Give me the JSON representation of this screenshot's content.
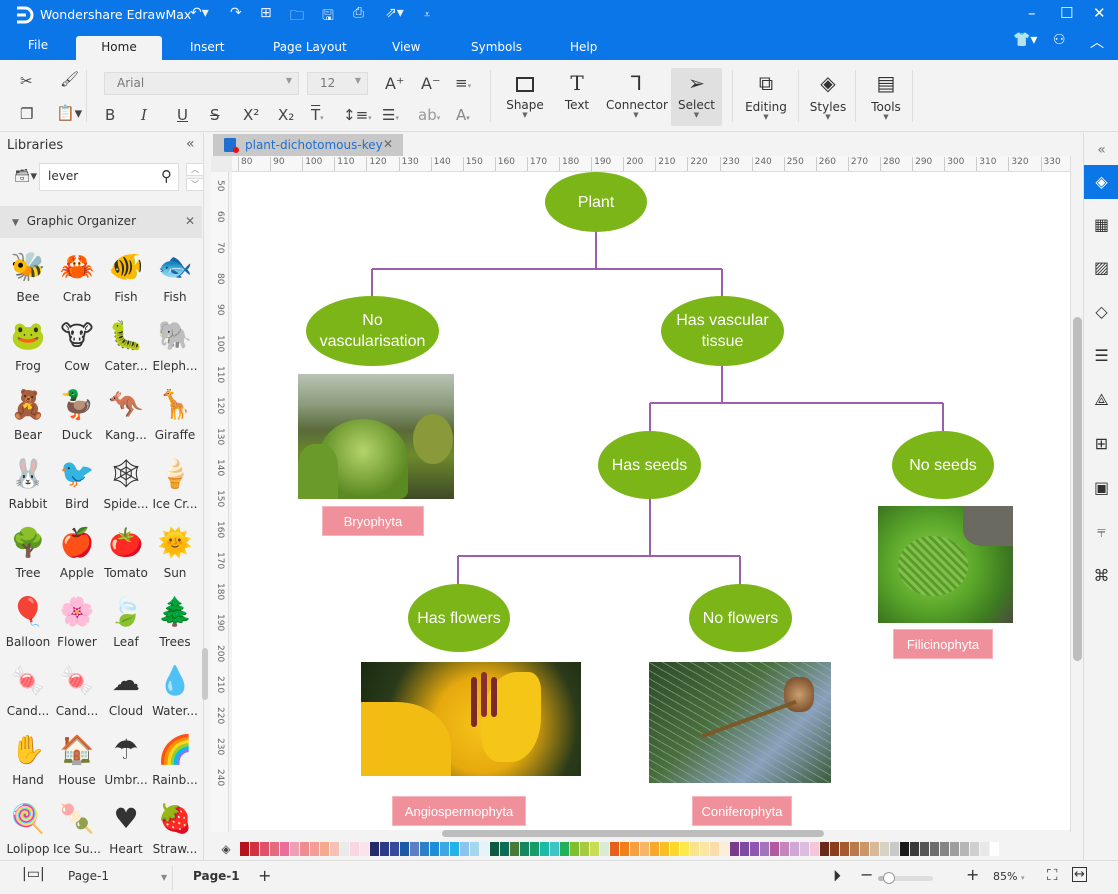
{
  "app": {
    "title": "Wondershare EdrawMax",
    "quick_access": [
      "undo-icon",
      "redo-icon",
      "new-icon",
      "open-icon",
      "save-icon",
      "print-icon",
      "export-icon",
      "customize-icon"
    ],
    "window_controls": {
      "minimize": "–",
      "maximize": "☐",
      "close": "✕"
    }
  },
  "menu": {
    "tabs": [
      "File",
      "Home",
      "Insert",
      "Page Layout",
      "View",
      "Symbols",
      "Help"
    ],
    "active": "Home"
  },
  "ribbon": {
    "font_name": "Arial",
    "font_size": "12",
    "buttons": [
      {
        "label": "Shape",
        "icon": "□"
      },
      {
        "label": "Text",
        "icon": "T"
      },
      {
        "label": "Connector",
        "icon": "⌐"
      },
      {
        "label": "Select",
        "icon": "⇖"
      },
      {
        "label": "Editing",
        "icon": "⧉"
      },
      {
        "label": "Styles",
        "icon": "◈"
      },
      {
        "label": "Tools",
        "icon": "▤"
      }
    ],
    "format_icons": {
      "bold": "B",
      "italic": "I",
      "underline": "U",
      "strike": "S",
      "superscript": "X²",
      "subscript": "X₂",
      "grow": "A⁺",
      "shrink": "A⁻",
      "align": "≡",
      "text": "T",
      "spacing": "↕≡",
      "list": "☰",
      "highlight": "ab",
      "fontcolor": "A"
    }
  },
  "library": {
    "title": "Libraries",
    "search_value": "lever",
    "category": "Graphic Organizer",
    "shapes": [
      {
        "name": "Bee",
        "glyph": "🐝"
      },
      {
        "name": "Crab",
        "glyph": "🦀"
      },
      {
        "name": "Fish",
        "glyph": "🐠"
      },
      {
        "name": "Fish",
        "glyph": "🐟"
      },
      {
        "name": "Frog",
        "glyph": "🐸"
      },
      {
        "name": "Cow",
        "glyph": "🐮"
      },
      {
        "name": "Cater...",
        "glyph": "🐛"
      },
      {
        "name": "Eleph...",
        "glyph": "🐘"
      },
      {
        "name": "Bear",
        "glyph": "🧸"
      },
      {
        "name": "Duck",
        "glyph": "🦆"
      },
      {
        "name": "Kang...",
        "glyph": "🦘"
      },
      {
        "name": "Giraffe",
        "glyph": "🦒"
      },
      {
        "name": "Rabbit",
        "glyph": "🐰"
      },
      {
        "name": "Bird",
        "glyph": "🐦"
      },
      {
        "name": "Spide...",
        "glyph": "🕸"
      },
      {
        "name": "Ice Cr...",
        "glyph": "🍦"
      },
      {
        "name": "Tree",
        "glyph": "🌳"
      },
      {
        "name": "Apple",
        "glyph": "🍎"
      },
      {
        "name": "Tomato",
        "glyph": "🍅"
      },
      {
        "name": "Sun",
        "glyph": "🌞"
      },
      {
        "name": "Balloon",
        "glyph": "🎈"
      },
      {
        "name": "Flower",
        "glyph": "🌸"
      },
      {
        "name": "Leaf",
        "glyph": "🍃"
      },
      {
        "name": "Trees",
        "glyph": "🌲"
      },
      {
        "name": "Cand...",
        "glyph": "🍬"
      },
      {
        "name": "Cand...",
        "glyph": "🍬"
      },
      {
        "name": "Cloud",
        "glyph": "☁"
      },
      {
        "name": "Water...",
        "glyph": "💧"
      },
      {
        "name": "Hand",
        "glyph": "✋"
      },
      {
        "name": "House",
        "glyph": "🏠"
      },
      {
        "name": "Umbr...",
        "glyph": "☂"
      },
      {
        "name": "Rainb...",
        "glyph": "🌈"
      },
      {
        "name": "Lolipop",
        "glyph": "🍭"
      },
      {
        "name": "Ice Su...",
        "glyph": "🍡"
      },
      {
        "name": "Heart",
        "glyph": "♥"
      },
      {
        "name": "Straw...",
        "glyph": "🍓"
      }
    ]
  },
  "document": {
    "tab_title": "plant-dichotomous-key",
    "hruler": [
      "80",
      "90",
      "100",
      "110",
      "120",
      "130",
      "140",
      "150",
      "160",
      "170",
      "180",
      "190",
      "200",
      "210",
      "220",
      "230",
      "240",
      "250",
      "260",
      "270",
      "280",
      "290",
      "300",
      "310",
      "320",
      "330"
    ],
    "vruler": [
      "50",
      "60",
      "70",
      "80",
      "90",
      "100",
      "110",
      "120",
      "130",
      "140",
      "150",
      "160",
      "170",
      "180",
      "190",
      "200",
      "210",
      "220",
      "230",
      "240"
    ]
  },
  "diagram": {
    "node_color": "#7cb518",
    "connector_color": "#9b5fad",
    "tag_color": "#f0909a",
    "nodes": {
      "plant": "Plant",
      "no_vasc_1": "No",
      "no_vasc_2": "vascularisation",
      "has_vasc_1": "Has vascular",
      "has_vasc_2": "tissue",
      "has_seeds": "Has seeds",
      "no_seeds": "No seeds",
      "has_flowers": "Has flowers",
      "no_flowers": "No flowers"
    },
    "tags": {
      "bryophyta": "Bryophyta",
      "filicinophyta": "Filicinophyta",
      "angiosperm": "Angiospermophyta",
      "conifer": "Coniferophyta"
    },
    "photos": [
      "moss",
      "fern",
      "lily",
      "pine"
    ]
  },
  "palette": [
    "#b5121b",
    "#d2343f",
    "#e0506a",
    "#e56a7d",
    "#ea6d9b",
    "#ef9fb6",
    "#f08b8f",
    "#f39d96",
    "#f5a98e",
    "#f6c2b4",
    "#eaeaea",
    "#fad6e2",
    "#f8e4ea",
    "#252a6b",
    "#2e3a87",
    "#364a9b",
    "#1d5aa6",
    "#5f7fc4",
    "#2d7fc8",
    "#1c8fd8",
    "#3da6e3",
    "#24b3e8",
    "#8bc4ea",
    "#a6d5ee",
    "#e6f3fa",
    "#0f5a3e",
    "#0e6b56",
    "#4b7a36",
    "#16875d",
    "#189a6b",
    "#1db9a4",
    "#3ec4c5",
    "#23af5b",
    "#7dbf2f",
    "#a6cb3e",
    "#c9dd52",
    "#d8ebd9",
    "#e85f1c",
    "#f07f1a",
    "#f5a040",
    "#f7b567",
    "#f7a92b",
    "#fbbf26",
    "#fcd72c",
    "#fde94c",
    "#f9e38c",
    "#fbe7a2",
    "#fcdcaa",
    "#fbeeda",
    "#7a3b8a",
    "#7d4ba1",
    "#8e56b0",
    "#a274bb",
    "#b35a9e",
    "#c385ba",
    "#cfa6d4",
    "#dcbde0",
    "#f5c6d6",
    "#6b2a16",
    "#8a3c1c",
    "#a65a2f",
    "#b97a4b",
    "#c8976a",
    "#d9b899",
    "#d6d3c5",
    "#c9c9c9",
    "#1a1a1a",
    "#3b3b3b",
    "#555555",
    "#6d6d6d",
    "#858585",
    "#9e9e9e",
    "#b6b6b6",
    "#cfcfcf",
    "#e8e8e8",
    "#ffffff"
  ],
  "status": {
    "page_selector": "Page-1",
    "page_tab": "Page-1",
    "zoom": "85%",
    "zoom_level_fraction": 0.12
  },
  "rightbar_icons": [
    "collapse-icon",
    "fill-icon",
    "grid-icon",
    "image-icon",
    "layers-icon",
    "page-properties-icon",
    "chart-icon",
    "table-icon",
    "org-icon",
    "timeline-icon",
    "mindmap-icon"
  ]
}
